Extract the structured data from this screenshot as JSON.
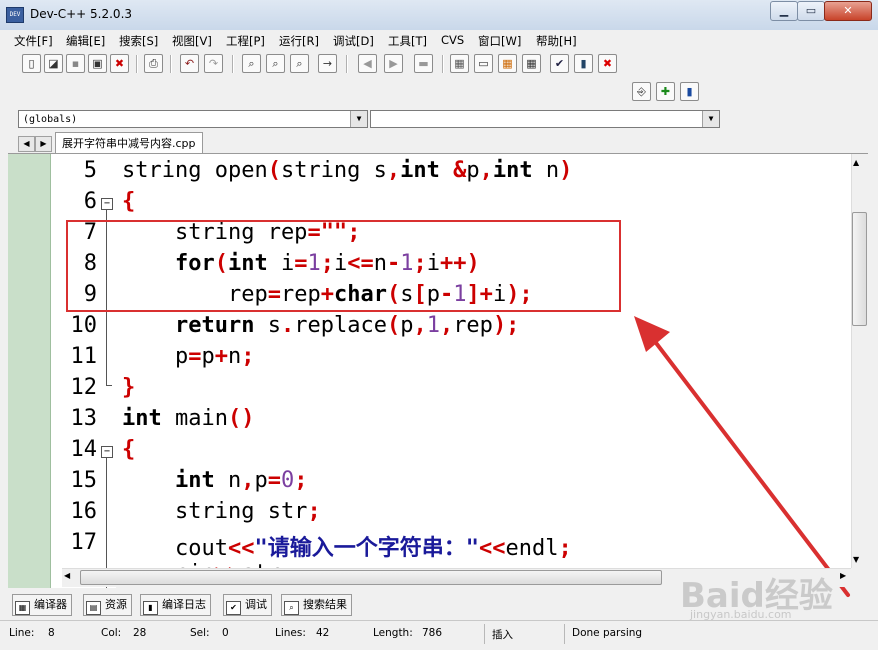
{
  "window": {
    "title": "Dev-C++ 5.2.0.3",
    "icon_text": "DEV"
  },
  "menu": [
    "文件[F]",
    "编辑[E]",
    "搜索[S]",
    "视图[V]",
    "工程[P]",
    "运行[R]",
    "调试[D]",
    "工具[T]",
    "CVS",
    "窗口[W]",
    "帮助[H]"
  ],
  "combos": {
    "scope": "(globals)",
    "symbol": ""
  },
  "file_tab": "展开字符串中减号内容.cpp",
  "lines": [
    "5",
    "6",
    "7",
    "8",
    "9",
    "10",
    "11",
    "12",
    "13",
    "14",
    "15",
    "16",
    "17"
  ],
  "bottom_tabs": [
    "编译器",
    "资源",
    "编译日志",
    "调试",
    "搜索结果"
  ],
  "status": {
    "line_label": "Line:",
    "line": "8",
    "col_label": "Col:",
    "col": "28",
    "sel_label": "Sel:",
    "sel": "0",
    "lines_label": "Lines:",
    "lines": "42",
    "length_label": "Length:",
    "length": "786",
    "mode": "插入",
    "message": "Done parsing"
  },
  "watermark": {
    "main": "Baid经验",
    "sub": "jingyan.baidu.com"
  },
  "colors": {
    "highlight_line": "#c6f0f2",
    "annotation_red": "#d93030",
    "operator": "#cc0000",
    "number": "#7b3fa0",
    "string": "#0000c8"
  }
}
